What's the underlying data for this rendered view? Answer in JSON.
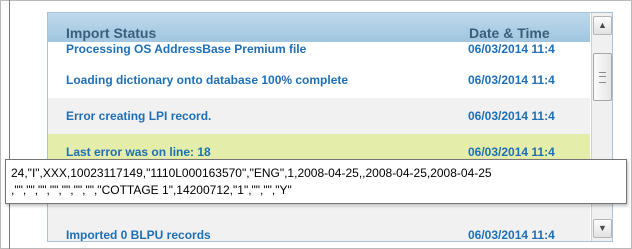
{
  "grid": {
    "headers": {
      "status": "Import Status",
      "datetime": "Date & Time"
    },
    "rows": [
      {
        "status": "Processing OS AddressBase Premium file",
        "datetime": "06/03/2014 11:4"
      },
      {
        "status": "Loading dictionary onto database 100% complete",
        "datetime": "06/03/2014 11:4"
      },
      {
        "status": "Error creating LPI record.",
        "datetime": "06/03/2014 11:4"
      },
      {
        "status": "Last error was on line: 18",
        "datetime": "06/03/2014 11:4"
      },
      {
        "status": "",
        "datetime": ""
      },
      {
        "status": "Imported 0 BLPU records",
        "datetime": "06/03/2014 11:4"
      }
    ]
  },
  "tooltip": {
    "line1": "24,\"I\",XXX,10023117149,\"1110L000163570\",\"ENG\",1,2008-04-25,,2008-04-25,2008-04-25",
    "line2": ",\"\",\"\",\"\",\"\",\"\",\"\",\"\",\"COTTAGE 1\",14200712,\"1\",\"\",\"\",\"Y\""
  },
  "scrollbar": {
    "up_icon": "chevron-up-icon",
    "down_icon": "chevron-down-icon"
  },
  "colors": {
    "header_bg": "#a9cbe3",
    "link_text": "#1f6fb5",
    "highlight_row": "#e4edaa"
  }
}
